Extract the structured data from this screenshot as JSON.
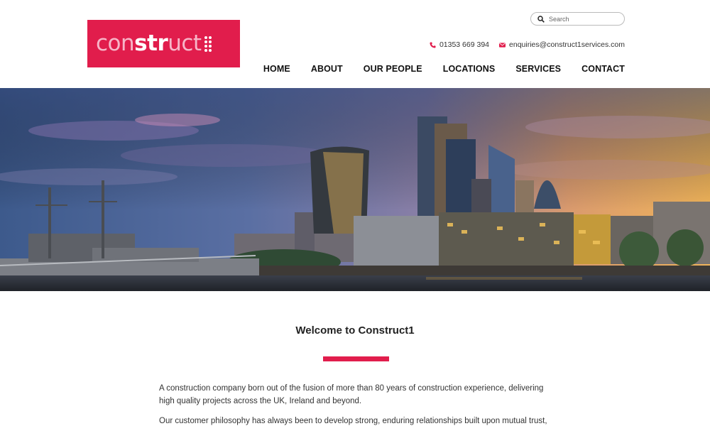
{
  "brand": {
    "logo_part1": "con",
    "logo_part2": "str",
    "logo_part3": "uct",
    "accent_color": "#e11d4c"
  },
  "search": {
    "placeholder": "Search"
  },
  "contact": {
    "phone": "01353 669 394",
    "email": "enquiries@construct1services.com"
  },
  "nav": {
    "items": [
      {
        "label": "HOME"
      },
      {
        "label": "ABOUT"
      },
      {
        "label": "OUR PEOPLE"
      },
      {
        "label": "LOCATIONS"
      },
      {
        "label": "SERVICES"
      },
      {
        "label": "CONTACT"
      }
    ]
  },
  "hero": {
    "image": "city-skyline-at-sunset"
  },
  "main": {
    "title": "Welcome to Construct1",
    "paragraphs": [
      "A construction company born out of the fusion of more than 80 years of construction experience, delivering high quality projects across the UK, Ireland and beyond.",
      "Our customer philosophy has always been to develop strong, enduring relationships built upon mutual trust,"
    ]
  }
}
